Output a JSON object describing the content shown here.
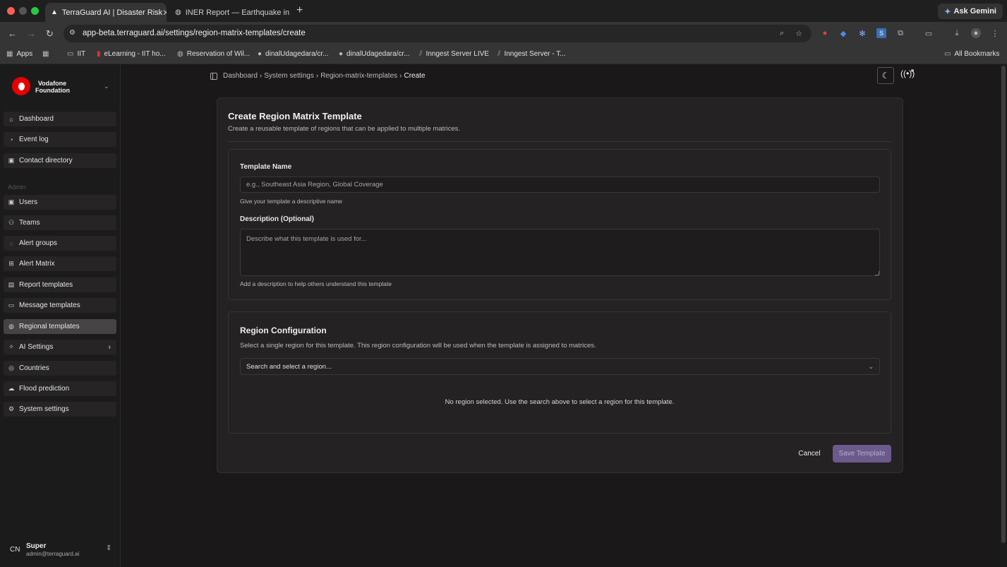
{
  "browser": {
    "tabs": [
      {
        "label": "TerraGuard AI | Disaster Risk",
        "active": true
      },
      {
        "label": "INER Report — Earthquake in",
        "active": false
      }
    ],
    "ask_gemini": "Ask Gemini",
    "url": "app-beta.terraguard.ai/settings/region-matrix-templates/create",
    "bookmarks": [
      "Apps",
      "IIT",
      "eLearning - IIT ho...",
      "Reservation of Wil...",
      "dinalUdagedara/cr...",
      "dinalUdagedara/cr...",
      "Inngest Server LIVE",
      "Inngest Server - T..."
    ],
    "all_bookmarks": "All Bookmarks"
  },
  "brand": {
    "line1": "Vodafone",
    "line2": "Foundation"
  },
  "sidebar": {
    "items_top": [
      {
        "label": "Dashboard",
        "icon": "home-icon"
      },
      {
        "label": "Event log",
        "icon": "event-log-icon"
      },
      {
        "label": "Contact directory",
        "icon": "contact-icon"
      }
    ],
    "admin_label": "Admin",
    "items_admin": [
      {
        "label": "Users",
        "icon": "users-icon"
      },
      {
        "label": "Teams",
        "icon": "teams-icon"
      },
      {
        "label": "Alert groups",
        "icon": "alert-groups-icon"
      },
      {
        "label": "Alert Matrix",
        "icon": "matrix-icon"
      },
      {
        "label": "Report templates",
        "icon": "report-icon"
      },
      {
        "label": "Message templates",
        "icon": "message-icon"
      },
      {
        "label": "Regional templates",
        "icon": "globe-icon",
        "active": true
      },
      {
        "label": "AI Settings",
        "icon": "ai-icon",
        "has_chevron": true
      },
      {
        "label": "Countries",
        "icon": "countries-icon"
      },
      {
        "label": "Flood prediction",
        "icon": "cloud-icon"
      },
      {
        "label": "System settings",
        "icon": "gear-icon"
      }
    ],
    "user": {
      "initials": "CN",
      "name": "Super",
      "email": "admin@terraguard.ai"
    }
  },
  "breadcrumb": {
    "items": [
      "Dashboard",
      "System settings",
      "Region-matrix-templates",
      "Create"
    ]
  },
  "form": {
    "title": "Create Region Matrix Template",
    "subtitle": "Create a reusable template of regions that can be applied to multiple matrices.",
    "name_label": "Template Name",
    "name_placeholder": "e.g., Southeast Asia Region, Global Coverage",
    "name_hint": "Give your template a descriptive name",
    "desc_label": "Description (Optional)",
    "desc_placeholder": "Describe what this template is used for...",
    "desc_hint": "Add a description to help others understand this template",
    "region_title": "Region Configuration",
    "region_subtitle": "Select a single region for this template. This region configuration will be used when the template is assigned to matrices.",
    "region_select": "Search and select a region...",
    "empty_message": "No region selected. Use the search above to select a region for this template.",
    "cancel": "Cancel",
    "save": "Save Template"
  },
  "colors": {
    "accent": "#6b5a8c",
    "vodafone_red": "#e60000"
  }
}
